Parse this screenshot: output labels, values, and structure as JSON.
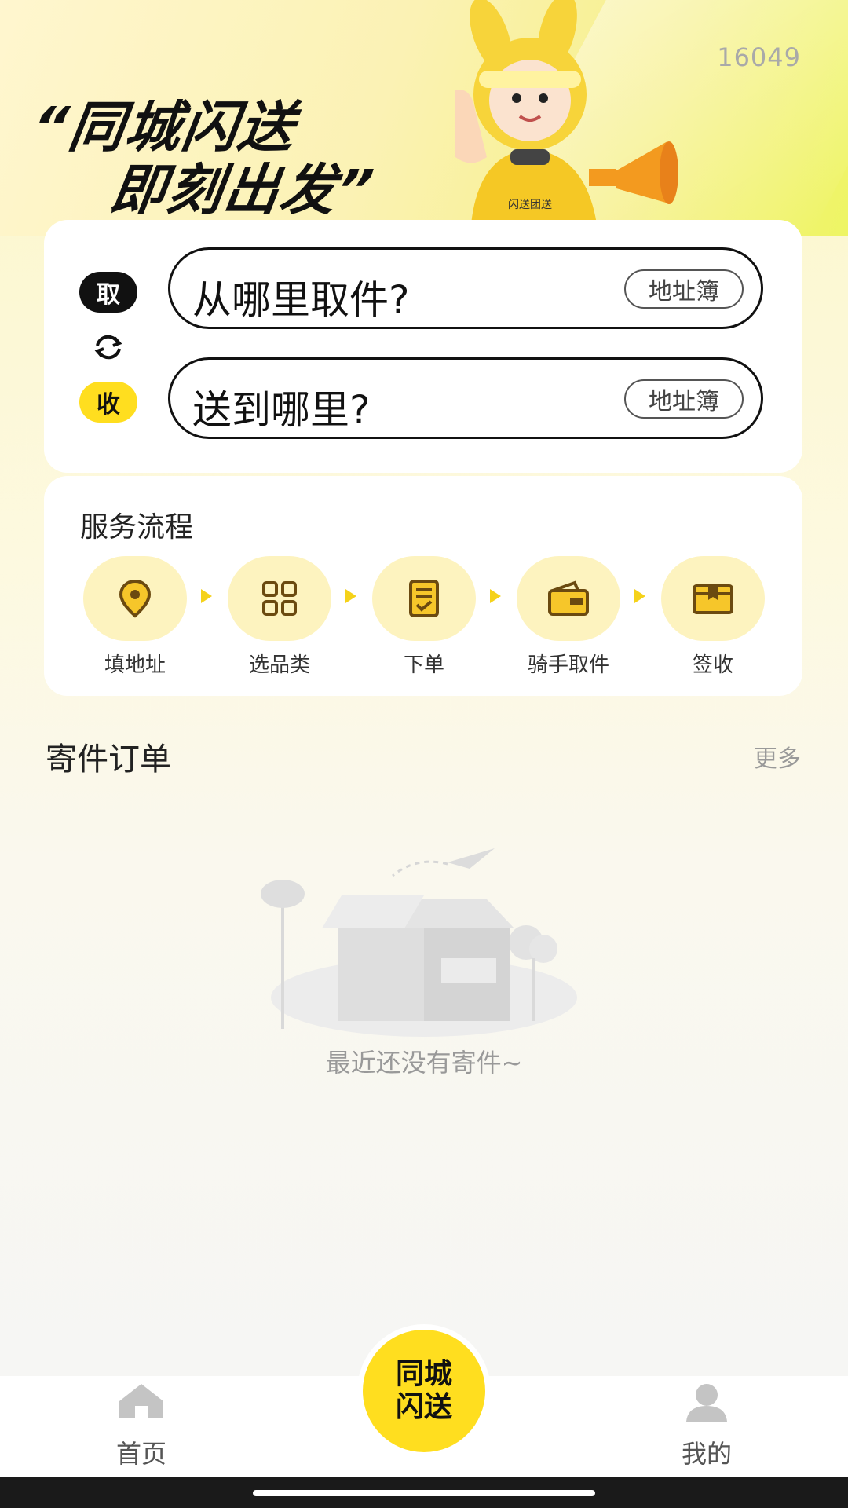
{
  "header": {
    "code": "16049",
    "slogan_line1": "“同城闪送",
    "slogan_line2": "即刻出发”",
    "mascot_badge": "闪送团送"
  },
  "address": {
    "pickup_tag": "取",
    "receive_tag": "收",
    "pickup_placeholder": "从哪里取件?",
    "receive_placeholder": "送到哪里?",
    "address_book_label": "地址簿"
  },
  "service": {
    "title": "服务流程",
    "steps": [
      {
        "label": "填地址",
        "icon": "location-pin-icon"
      },
      {
        "label": "选品类",
        "icon": "grid-icon"
      },
      {
        "label": "下单",
        "icon": "checklist-icon"
      },
      {
        "label": "骑手取件",
        "icon": "wallet-icon"
      },
      {
        "label": "签收",
        "icon": "package-icon"
      }
    ]
  },
  "orders": {
    "title": "寄件订单",
    "more": "更多",
    "empty_text": "最近还没有寄件~"
  },
  "nav": {
    "home": "首页",
    "center_line1": "同城",
    "center_line2": "闪送",
    "mine": "我的"
  },
  "colors": {
    "accent": "#ffde1f",
    "step_bg": "#fdf3bf",
    "icon_brown": "#6b4a10"
  }
}
